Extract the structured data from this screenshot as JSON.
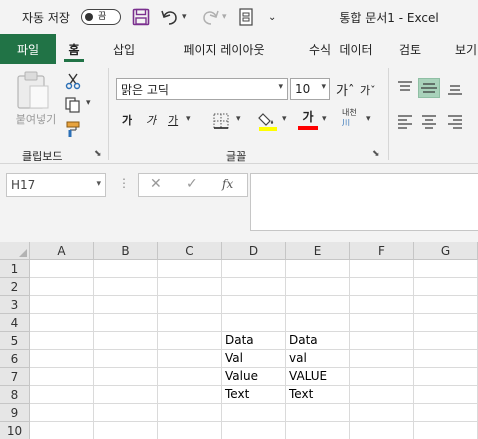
{
  "titlebar": {
    "autosave_label": "자동 저장",
    "autosave_state": "끔",
    "doc_title": "통합 문서1  -  Excel"
  },
  "tabs": [
    {
      "label": "파일"
    },
    {
      "label": "홈"
    },
    {
      "label": "삽입"
    },
    {
      "label": "페이지 레이아웃"
    },
    {
      "label": "수식"
    },
    {
      "label": "데이터"
    },
    {
      "label": "검토"
    },
    {
      "label": "보기"
    }
  ],
  "ribbon": {
    "paste_label": "붙여넣기",
    "clipboard_group": "클립보드",
    "font_group": "글꼴",
    "font_name": "맑은 고딕",
    "font_size": "10",
    "grow_label": "가ˆ",
    "shrink_label": "가ˇ",
    "bold_label": "가",
    "italic_label": "가",
    "underline_label": "가",
    "fontcolor_label": "가",
    "phonetic_label": "내천",
    "accent_color": "#217346",
    "fill_color": "#ffff00",
    "font_color": "#ff0000"
  },
  "formula": {
    "name_box": "H17",
    "fx_label": "fx",
    "value": ""
  },
  "grid": {
    "columns": [
      "A",
      "B",
      "C",
      "D",
      "E",
      "F",
      "G"
    ],
    "rows": [
      "1",
      "2",
      "3",
      "4",
      "5",
      "6",
      "7",
      "8",
      "9",
      "10"
    ],
    "cells": {
      "D5": "Data",
      "E5": "Data",
      "D6": "Val",
      "E6": "val",
      "D7": "Value",
      "E7": "VALUE",
      "D8": "Text",
      "E8": "Text"
    }
  }
}
